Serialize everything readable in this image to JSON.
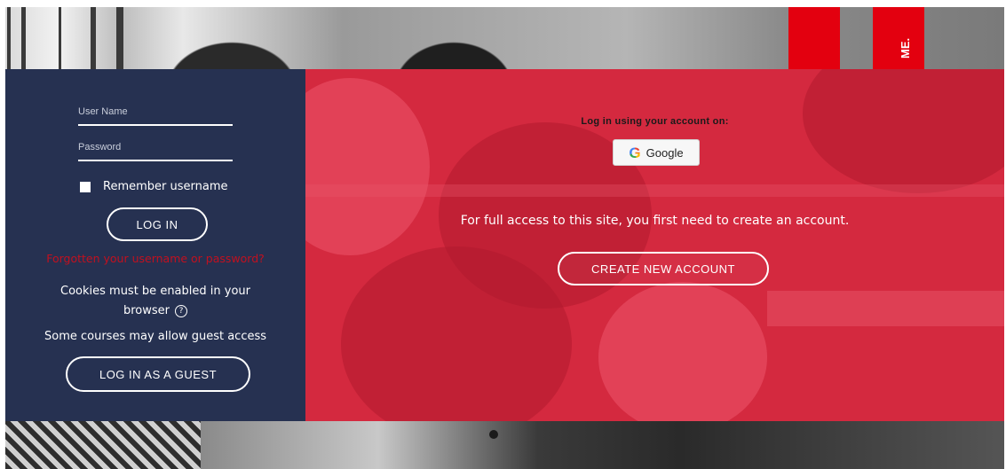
{
  "login": {
    "username_placeholder": "User Name",
    "password_placeholder": "Password",
    "remember_label": "Remember username",
    "login_button": "LOG IN",
    "forgot_link": "Forgotten your username or password?",
    "cookies_notice": "Cookies must be enabled in your browser",
    "guest_notice": "Some courses may allow guest access",
    "guest_button": "LOG IN AS A GUEST"
  },
  "signup": {
    "auth_heading": "Log in using your account on:",
    "google_label": "Google",
    "access_text": "For full access to this site, you first need to create an account.",
    "create_button": "CREATE NEW ACCOUNT"
  },
  "brand": {
    "banner_text": "ME."
  },
  "icons": {
    "help": "question-circle-icon",
    "google": "google-g-icon"
  },
  "colors": {
    "login_panel": "#263151",
    "signup_panel": "#d4293f",
    "brand_red": "#e3000f",
    "forgot_link": "#c2101f"
  }
}
